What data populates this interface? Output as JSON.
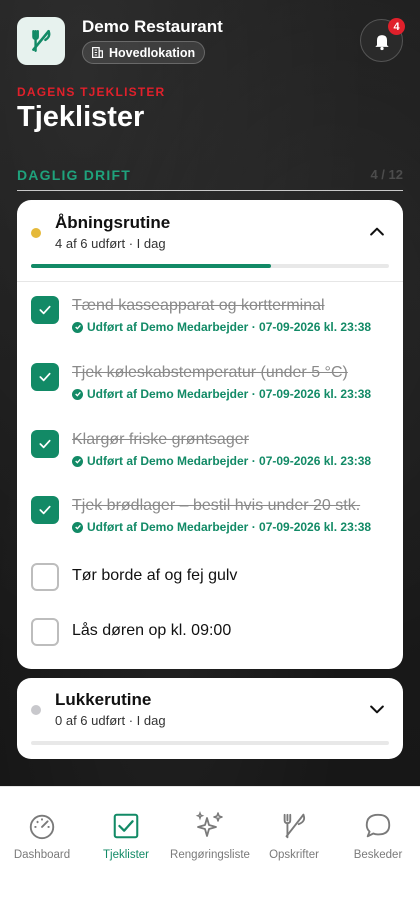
{
  "header": {
    "restaurant_name": "Demo Restaurant",
    "location": "Hovedlokation",
    "notification_count": "4"
  },
  "page": {
    "eyebrow": "DAGENS TJEKLISTER",
    "title": "Tjeklister"
  },
  "section": {
    "label": "DAGLIG DRIFT",
    "count": "4 / 12"
  },
  "checklists": [
    {
      "title": "Åbningsrutine",
      "subtitle": "4 af 6 udført · I dag",
      "status_color": "#e5b93a",
      "progress": 0.67,
      "expanded": true,
      "items": [
        {
          "label": "Tænd kasseapparat og kortterminal",
          "done": true,
          "meta": "Udført af Demo Medarbejder · 07-09-2026 kl. 23:38"
        },
        {
          "label": "Tjek køleskabstemperatur (under 5 °C)",
          "done": true,
          "meta": "Udført af Demo Medarbejder · 07-09-2026 kl. 23:38"
        },
        {
          "label": "Klargør friske grøntsager",
          "done": true,
          "meta": "Udført af Demo Medarbejder · 07-09-2026 kl. 23:38"
        },
        {
          "label": "Tjek brødlager – bestil hvis under 20 stk.",
          "done": true,
          "meta": "Udført af Demo Medarbejder · 07-09-2026 kl. 23:38"
        },
        {
          "label": "Tør borde af og fej gulv",
          "done": false,
          "meta": ""
        },
        {
          "label": "Lås døren op kl. 09:00",
          "done": false,
          "meta": ""
        }
      ]
    },
    {
      "title": "Lukkerutine",
      "subtitle": "0 af 6 udført · I dag",
      "status_color": "#c8c8cc",
      "progress": 0,
      "expanded": false,
      "items": []
    }
  ],
  "nav": [
    {
      "label": "Dashboard",
      "icon": "gauge-icon",
      "active": false
    },
    {
      "label": "Tjeklister",
      "icon": "checkbox-icon",
      "active": true
    },
    {
      "label": "Rengøringsliste",
      "icon": "sparkles-icon",
      "active": false
    },
    {
      "label": "Opskrifter",
      "icon": "utensils-icon",
      "active": false
    },
    {
      "label": "Beskeder",
      "icon": "chat-bubble-icon",
      "active": false
    }
  ],
  "colors": {
    "accent": "#128a66",
    "accent_light": "#1fa27c",
    "alert": "#e0202b"
  }
}
